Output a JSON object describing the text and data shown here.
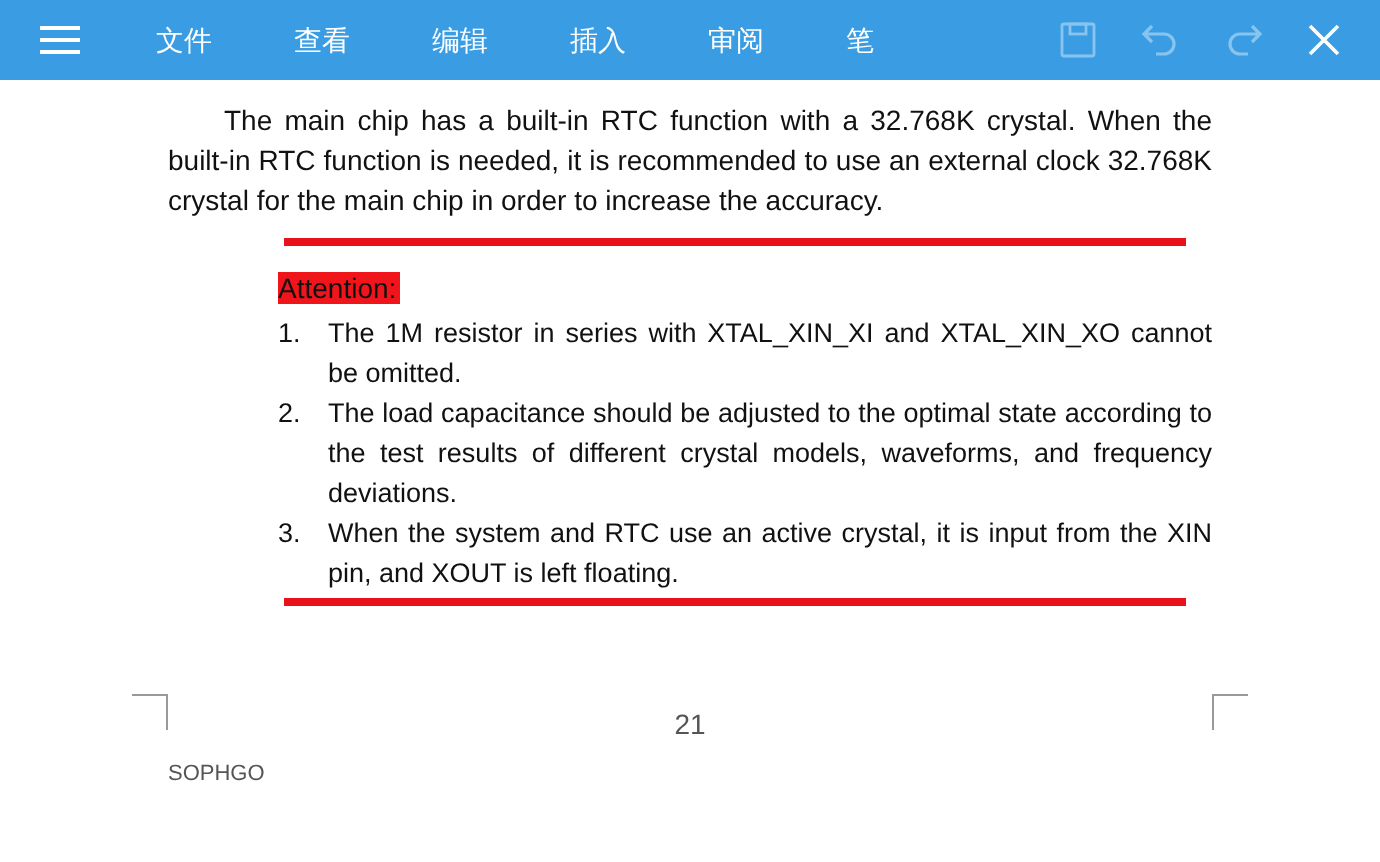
{
  "toolbar": {
    "menu": [
      {
        "label": "文件"
      },
      {
        "label": "查看"
      },
      {
        "label": "编辑"
      },
      {
        "label": "插入"
      },
      {
        "label": "审阅"
      },
      {
        "label": "笔"
      }
    ],
    "actions": [
      {
        "kind": "save",
        "disabled": true
      },
      {
        "kind": "undo",
        "disabled": true
      },
      {
        "kind": "redo",
        "disabled": true
      },
      {
        "kind": "close",
        "disabled": false
      }
    ]
  },
  "document": {
    "paragraph": "The main chip has a built-in RTC function with a 32.768K crystal. When the built-in RTC function is needed, it is recommended to use an external clock 32.768K crystal for the main chip in order to increase the accuracy.",
    "attention": "Attention:",
    "list": [
      {
        "number": "1.",
        "text": "The 1M resistor in series with XTAL_XIN_XI and XTAL_XIN_XO cannot be omitted."
      },
      {
        "number": "2.",
        "text": "The load capacitance should be adjusted to the optimal state according to the test results of different crystal models, waveforms, and frequency deviations."
      },
      {
        "number": "3.",
        "text": "When the system and RTC use an active crystal, it is input from the XIN pin, and XOUT is left floating."
      }
    ],
    "page_number": "21",
    "footer": "SOPHGO"
  }
}
